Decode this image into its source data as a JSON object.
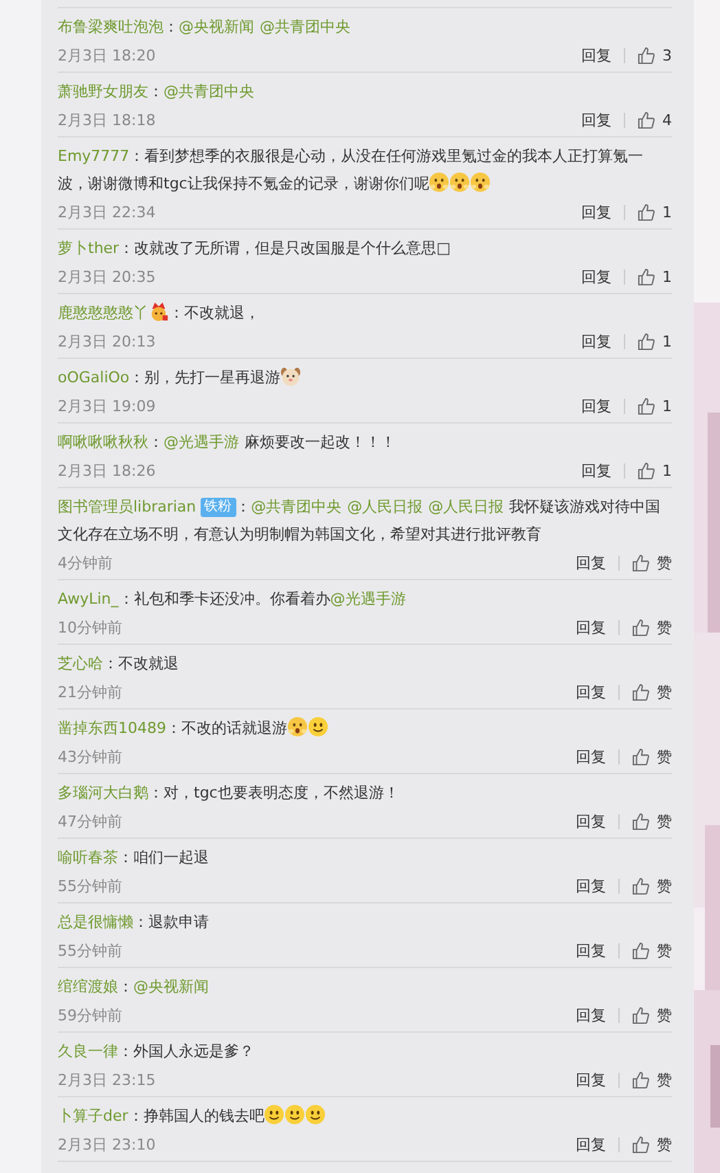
{
  "comments": [
    {
      "user": "布鲁梁爽吐泡泡",
      "parts": [
        {
          "kind": "text",
          "text": "："
        },
        {
          "kind": "mention",
          "text": "@央视新闻"
        },
        {
          "kind": "mention",
          "text": "@共青团中央"
        }
      ],
      "time": "2月3日 18:20",
      "reply": "回复",
      "likes": "3"
    },
    {
      "user": "萧驰野女朋友",
      "parts": [
        {
          "kind": "text",
          "text": "："
        },
        {
          "kind": "mention",
          "text": "@共青团中央"
        }
      ],
      "time": "2月3日 18:18",
      "reply": "回复",
      "likes": "4"
    },
    {
      "user": "Emy7777",
      "parts": [
        {
          "kind": "text",
          "text": "：看到梦想季的衣服很是心动，从没在任何游戏里氪过金的我本人正打算氪一波，谢谢微博和tgc让我保持不氪金的记录，谢谢你们呢"
        },
        {
          "kind": "shock"
        },
        {
          "kind": "shock"
        },
        {
          "kind": "shock"
        }
      ],
      "time": "2月3日 22:34",
      "reply": "回复",
      "likes": "1"
    },
    {
      "user": "萝卜ther",
      "parts": [
        {
          "kind": "text",
          "text": "：改就改了无所谓，但是只改国服是个什么意思□"
        }
      ],
      "time": "2月3日 20:35",
      "reply": "回复",
      "likes": "1"
    },
    {
      "user": "鹿憨憨憨憨丫",
      "parts": [
        {
          "kind": "crown"
        },
        {
          "kind": "text",
          "text": "：不改就退，"
        }
      ],
      "time": "2月3日 20:13",
      "reply": "回复",
      "likes": "1"
    },
    {
      "user": "oOGaliOo",
      "parts": [
        {
          "kind": "text",
          "text": "：别，先打一星再退游"
        },
        {
          "kind": "dog"
        }
      ],
      "time": "2月3日 19:09",
      "reply": "回复",
      "likes": "1"
    },
    {
      "user": "啊啾啾啾秋秋",
      "parts": [
        {
          "kind": "text",
          "text": "："
        },
        {
          "kind": "mention",
          "text": "@光遇手游"
        },
        {
          "kind": "text",
          "text": "麻烦要改一起改！！！"
        }
      ],
      "time": "2月3日 18:26",
      "reply": "回复",
      "likes": "1"
    },
    {
      "user": "图书管理员librarian",
      "parts": [
        {
          "kind": "badge",
          "text": "铁粉"
        },
        {
          "kind": "text",
          "text": "："
        },
        {
          "kind": "mention",
          "text": "@共青团中央"
        },
        {
          "kind": "mention",
          "text": "@人民日报"
        },
        {
          "kind": "mention",
          "text": "@人民日报"
        },
        {
          "kind": "text",
          "text": "我怀疑该游戏对待中国文化存在立场不明，有意认为明制帽为韩国文化，希望对其进行批评教育"
        }
      ],
      "time": "4分钟前",
      "reply": "回复",
      "likes": "赞"
    },
    {
      "user": "AwyLin_",
      "parts": [
        {
          "kind": "text",
          "text": "：礼包和季卡还没冲。你看着办"
        },
        {
          "kind": "mention",
          "text": "@光遇手游"
        }
      ],
      "time": "10分钟前",
      "reply": "回复",
      "likes": "赞"
    },
    {
      "user": "芝心哈",
      "parts": [
        {
          "kind": "text",
          "text": "：不改就退"
        }
      ],
      "time": "21分钟前",
      "reply": "回复",
      "likes": "赞"
    },
    {
      "user": "凿掉东西10489",
      "parts": [
        {
          "kind": "text",
          "text": "：不改的话就退游"
        },
        {
          "kind": "shock"
        },
        {
          "kind": "smile"
        }
      ],
      "time": "43分钟前",
      "reply": "回复",
      "likes": "赞"
    },
    {
      "user": "多瑙河大白鹅",
      "parts": [
        {
          "kind": "text",
          "text": "：对，tgc也要表明态度，不然退游！"
        }
      ],
      "time": "47分钟前",
      "reply": "回复",
      "likes": "赞"
    },
    {
      "user": "喻听春茶",
      "parts": [
        {
          "kind": "text",
          "text": "：咱们一起退"
        }
      ],
      "time": "55分钟前",
      "reply": "回复",
      "likes": "赞"
    },
    {
      "user": "总是很慵懒",
      "parts": [
        {
          "kind": "text",
          "text": "：退款申请"
        }
      ],
      "time": "55分钟前",
      "reply": "回复",
      "likes": "赞"
    },
    {
      "user": "绾绾渡娘",
      "parts": [
        {
          "kind": "text",
          "text": "："
        },
        {
          "kind": "mention",
          "text": "@央视新闻"
        }
      ],
      "time": "59分钟前",
      "reply": "回复",
      "likes": "赞"
    },
    {
      "user": "久良一律",
      "parts": [
        {
          "kind": "text",
          "text": "：外国人永远是爹？"
        }
      ],
      "time": "2月3日 23:15",
      "reply": "回复",
      "likes": "赞"
    },
    {
      "user": "卜算子der",
      "parts": [
        {
          "kind": "text",
          "text": "：挣韩国人的钱去吧"
        },
        {
          "kind": "smile"
        },
        {
          "kind": "smile"
        },
        {
          "kind": "smile"
        }
      ],
      "time": "2月3日 23:10",
      "reply": "回复",
      "likes": "赞"
    }
  ]
}
